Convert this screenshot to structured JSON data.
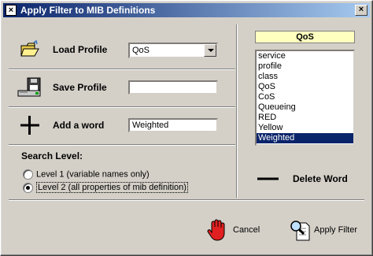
{
  "window": {
    "title": "Apply Filter to MIB Definitions",
    "close_glyph": "×",
    "app_glyph": "×"
  },
  "load_profile": {
    "label": "Load Profile",
    "value": "QoS"
  },
  "save_profile": {
    "label": "Save Profile",
    "value": ""
  },
  "add_word": {
    "label": "Add a word",
    "value": "Weighted"
  },
  "search_level": {
    "label": "Search Level:",
    "options": [
      {
        "label": "Level 1 (variable names only)",
        "checked": false
      },
      {
        "label": "Level 2 (all properties of mib definition)",
        "checked": true
      }
    ]
  },
  "word_list": {
    "header": "QoS",
    "items": [
      "service",
      "profile",
      "class",
      "QoS",
      "CoS",
      "Queueing",
      "RED",
      "Yellow",
      "Weighted"
    ],
    "selected": "Weighted"
  },
  "delete_word": {
    "label": "Delete Word"
  },
  "buttons": {
    "cancel": "Cancel",
    "apply": "Apply Filter"
  },
  "colors": {
    "title_start": "#0a246a",
    "title_end": "#a6caf0",
    "list_header_bg": "#ffffc0",
    "selection": "#0a246a",
    "cancel_hand": "#e02020"
  }
}
